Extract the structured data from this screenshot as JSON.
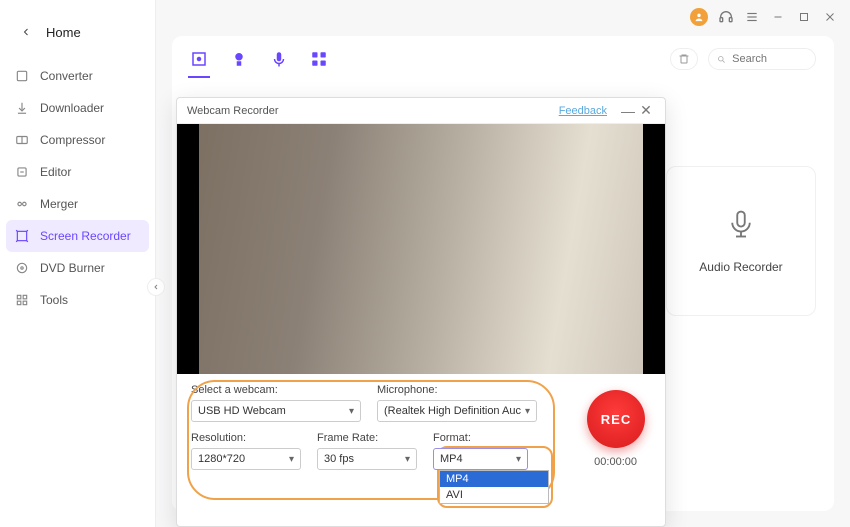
{
  "sidebar": {
    "home": "Home",
    "items": [
      {
        "label": "Converter"
      },
      {
        "label": "Downloader"
      },
      {
        "label": "Compressor"
      },
      {
        "label": "Editor"
      },
      {
        "label": "Merger"
      },
      {
        "label": "Screen Recorder"
      },
      {
        "label": "DVD Burner"
      },
      {
        "label": "Tools"
      }
    ]
  },
  "search": {
    "placeholder": "Search"
  },
  "audio_card": {
    "label": "Audio Recorder"
  },
  "modal": {
    "title": "Webcam Recorder",
    "feedback": "Feedback",
    "webcam_label": "Select a webcam:",
    "webcam_value": "USB HD Webcam",
    "mic_label": "Microphone:",
    "mic_value": "(Realtek High Definition Auc",
    "res_label": "Resolution:",
    "res_value": "1280*720",
    "fps_label": "Frame Rate:",
    "fps_value": "30 fps",
    "fmt_label": "Format:",
    "fmt_value": "MP4",
    "fmt_options": [
      "MP4",
      "AVI"
    ],
    "rec_label": "REC",
    "timer": "00:00:00"
  }
}
